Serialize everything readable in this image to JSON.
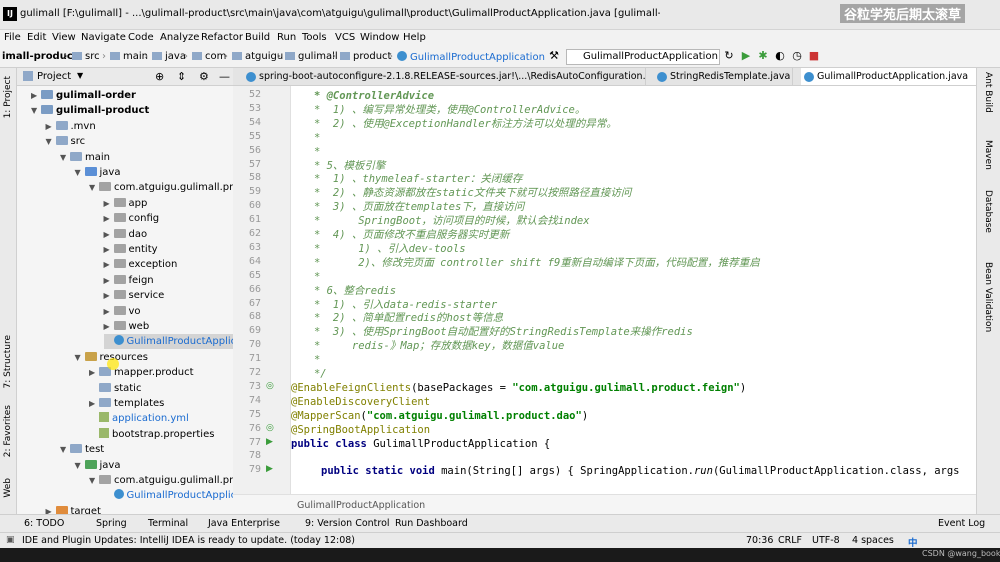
{
  "window": {
    "title": "gulimall [F:\\gulimall] - ...\\gulimall-product\\src\\main\\java\\com\\atguigu\\gulimall\\product\\GulimallProductApplication.java [gulimall-product] - IntelliJ IDEA",
    "watermark": "谷粒学苑后期太滚草",
    "close": "✕"
  },
  "menu": [
    "File",
    "Edit",
    "View",
    "Navigate",
    "Code",
    "Analyze",
    "Refactor",
    "Build",
    "Run",
    "Tools",
    "VCS",
    "Window",
    "Help"
  ],
  "nav": {
    "crumbs": [
      "imall-product",
      "src",
      "main",
      "java",
      "com",
      "atguigu",
      "gulimall",
      "product",
      "GulimallProductApplication"
    ],
    "run_config": "GulimallProductApplication"
  },
  "left_tabs": [
    "1: Project",
    "7: Structure",
    "2: Favorites",
    "Web"
  ],
  "right_tabs": [
    "Ant Build",
    "Maven",
    "Database",
    "Bean Validation"
  ],
  "project": {
    "header": "Project",
    "tree": [
      {
        "label": "gulimall-order",
        "indent": 1,
        "arrow": "▶",
        "icon": "mod",
        "bold": true
      },
      {
        "label": "gulimall-product",
        "indent": 1,
        "arrow": "▼",
        "icon": "mod",
        "bold": true
      },
      {
        "label": ".mvn",
        "indent": 2,
        "arrow": "▶",
        "icon": "dir"
      },
      {
        "label": "src",
        "indent": 2,
        "arrow": "▼",
        "icon": "dir"
      },
      {
        "label": "main",
        "indent": 3,
        "arrow": "▼",
        "icon": "dir"
      },
      {
        "label": "java",
        "indent": 4,
        "arrow": "▼",
        "icon": "src"
      },
      {
        "label": "com.atguigu.gulimall.produ",
        "indent": 5,
        "arrow": "▼",
        "icon": "pkg"
      },
      {
        "label": "app",
        "indent": 6,
        "arrow": "▶",
        "icon": "pkg"
      },
      {
        "label": "config",
        "indent": 6,
        "arrow": "▶",
        "icon": "pkg"
      },
      {
        "label": "dao",
        "indent": 6,
        "arrow": "▶",
        "icon": "pkg"
      },
      {
        "label": "entity",
        "indent": 6,
        "arrow": "▶",
        "icon": "pkg"
      },
      {
        "label": "exception",
        "indent": 6,
        "arrow": "▶",
        "icon": "pkg"
      },
      {
        "label": "feign",
        "indent": 6,
        "arrow": "▶",
        "icon": "pkg"
      },
      {
        "label": "service",
        "indent": 6,
        "arrow": "▶",
        "icon": "pkg"
      },
      {
        "label": "vo",
        "indent": 6,
        "arrow": "▶",
        "icon": "pkg"
      },
      {
        "label": "web",
        "indent": 6,
        "arrow": "▶",
        "icon": "pkg"
      },
      {
        "label": "GulimallProductApplicat",
        "indent": 6,
        "arrow": "",
        "icon": "class",
        "selected": true
      },
      {
        "label": "resources",
        "indent": 4,
        "arrow": "▼",
        "icon": "res"
      },
      {
        "label": "mapper.product",
        "indent": 5,
        "arrow": "▶",
        "icon": "dir"
      },
      {
        "label": "static",
        "indent": 5,
        "arrow": "",
        "icon": "dir"
      },
      {
        "label": "templates",
        "indent": 5,
        "arrow": "▶",
        "icon": "dir"
      },
      {
        "label": "application.yml",
        "indent": 5,
        "arrow": "",
        "icon": "yml",
        "link": true
      },
      {
        "label": "bootstrap.properties",
        "indent": 5,
        "arrow": "",
        "icon": "yml"
      },
      {
        "label": "test",
        "indent": 3,
        "arrow": "▼",
        "icon": "dir"
      },
      {
        "label": "java",
        "indent": 4,
        "arrow": "▼",
        "icon": "tst"
      },
      {
        "label": "com.atguigu.gulimall.produ",
        "indent": 5,
        "arrow": "▼",
        "icon": "pkg"
      },
      {
        "label": "GulimallProductApplicat",
        "indent": 6,
        "arrow": "",
        "icon": "class",
        "link": true
      },
      {
        "label": "target",
        "indent": 2,
        "arrow": "▶",
        "icon": "tgt"
      }
    ]
  },
  "tabs": [
    {
      "label": "spring-boot-autoconfigure-2.1.8.RELEASE-sources.jar!\\...\\RedisAutoConfiguration.java",
      "active": false
    },
    {
      "label": "StringRedisTemplate.java",
      "active": false
    },
    {
      "label": "GulimallProductApplication.java",
      "active": true
    }
  ],
  "editor": {
    "lines": [
      {
        "n": "52",
        "t": "   * @ControllerAdvice"
      },
      {
        "n": "53",
        "t": "   *  1) 、编写异常处理类，使用@ControllerAdvice。"
      },
      {
        "n": "54",
        "t": "   *  2) 、使用@ExceptionHandler标注方法可以处理的异常。"
      },
      {
        "n": "55",
        "t": "   *"
      },
      {
        "n": "56",
        "t": "   *"
      },
      {
        "n": "57",
        "t": "   * 5、模板引擎"
      },
      {
        "n": "58",
        "t": "   *  1) 、thymeleaf-starter：关闭缓存"
      },
      {
        "n": "59",
        "t": "   *  2) 、静态资源都放在static文件夹下就可以按照路径直接访问"
      },
      {
        "n": "60",
        "t": "   *  3) 、页面放在templates下，直接访问"
      },
      {
        "n": "61",
        "t": "   *      SpringBoot，访问项目的时候，默认会找index"
      },
      {
        "n": "62",
        "t": "   *  4) 、页面修改不重启服务器实时更新"
      },
      {
        "n": "63",
        "t": "   *      1) 、引入dev-tools"
      },
      {
        "n": "64",
        "t": "   *      2)、修改完页面 controller shift f9重新自动编译下页面，代码配置，推荐重启"
      },
      {
        "n": "65",
        "t": "   *"
      },
      {
        "n": "66",
        "t": "   * 6、整合redis"
      },
      {
        "n": "67",
        "t": "   *  1) 、引入data-redis-starter"
      },
      {
        "n": "68",
        "t": "   *  2) 、简单配置redis的host等信息"
      },
      {
        "n": "69",
        "t": "   *  3) 、使用SpringBoot自动配置好的StringRedisTemplate来操作redis"
      },
      {
        "n": "70",
        "t": "   *     redis-》Map；存放数据key，数据值value"
      },
      {
        "n": "71",
        "t": "   *"
      },
      {
        "n": "72",
        "t": "   */"
      }
    ],
    "code_lines": [
      {
        "n": "73",
        "a": "@EnableFeignClients",
        "b": "(basePackages = ",
        "s": "\"com.atguigu.gulimall.product.feign\"",
        "c": ")"
      },
      {
        "n": "74",
        "a": "@EnableDiscoveryClient",
        "b": "",
        "s": "",
        "c": ""
      },
      {
        "n": "75",
        "a": "@MapperScan",
        "b": "(",
        "s": "\"com.atguigu.gulimall.product.dao\"",
        "c": ")"
      },
      {
        "n": "76",
        "a": "@SpringBootApplication",
        "b": "",
        "s": "",
        "c": ""
      }
    ],
    "class_line": {
      "n": "77",
      "k": "public class ",
      "rest": "GulimallProductApplication {"
    },
    "blank_line": {
      "n": "78"
    },
    "main_line": {
      "n": "79",
      "k": "public static void ",
      "rest": "main(String[] args) { SpringApplication.",
      "m": "run",
      "tail": "(GulimallProductApplication.class, args"
    },
    "breadcrumb": "GulimallProductApplication"
  },
  "toolwindows": [
    "6: TODO",
    "Spring",
    "Terminal",
    "Java Enterprise",
    "9: Version Control",
    "Run Dashboard",
    "Event Log"
  ],
  "status": {
    "message": "IDE and Plugin Updates: IntelliJ IDEA is ready to update. (today 12:08)",
    "position": "70:36",
    "line_sep": "CRLF",
    "encoding": "UTF-8",
    "indent": "4 spaces",
    "ime": "中"
  },
  "csdn": "CSDN @wang_book"
}
